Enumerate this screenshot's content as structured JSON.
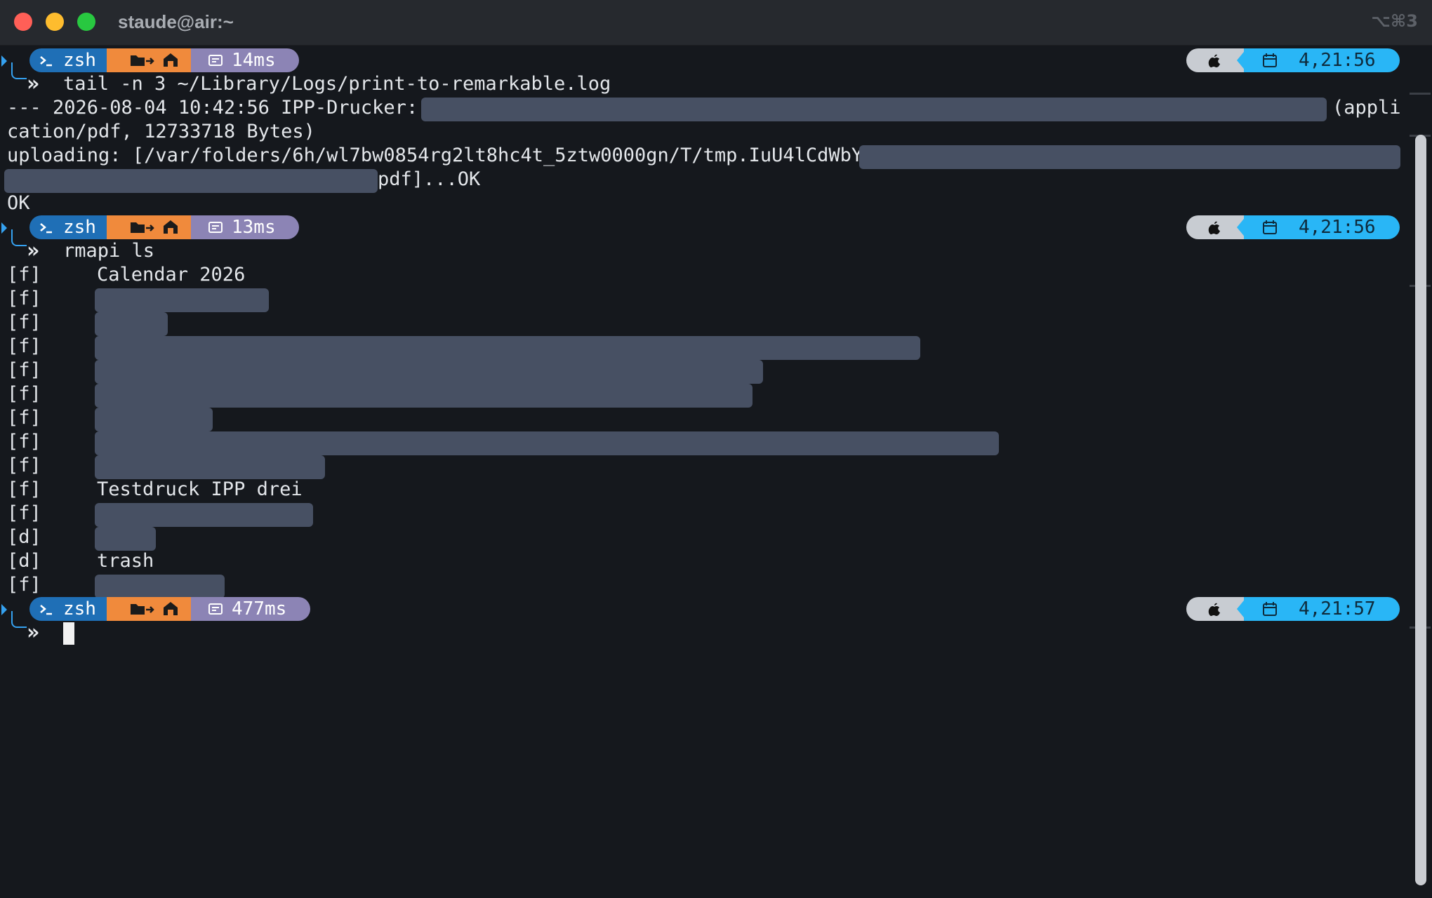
{
  "window": {
    "title": "staude@air:~",
    "shortcut": "⌥⌘3"
  },
  "prompts": [
    {
      "shell": "zsh",
      "duration": "14ms",
      "time": "4,21:56",
      "command": "tail -n 3 ~/Library/Logs/print-to-remarkable.log"
    },
    {
      "shell": "zsh",
      "duration": "13ms",
      "time": "4,21:56",
      "command": "rmapi ls"
    },
    {
      "shell": "zsh",
      "duration": "477ms",
      "time": "4,21:57",
      "command": ""
    }
  ],
  "log": {
    "line1_prefix": "--- 2026-08-04 10:42:56 IPP-Drucker: ",
    "line1_suffix": "(appli",
    "line2": "cation/pdf, 12733718 Bytes)",
    "line3": "uploading: [/var/folders/6h/wl7bw0854rg2lt8hc4t_5ztw0000gn/T/tmp.IuU4lCdWbY/",
    "line4_suffix": "pdf]...OK",
    "line5": "OK"
  },
  "listing": [
    {
      "type": "[f]",
      "name": "Calendar 2026"
    },
    {
      "type": "[f]",
      "name": ""
    },
    {
      "type": "[f]",
      "name": ""
    },
    {
      "type": "[f]",
      "name": ""
    },
    {
      "type": "[f]",
      "name": ""
    },
    {
      "type": "[f]",
      "name": ""
    },
    {
      "type": "[f]",
      "name": ""
    },
    {
      "type": "[f]",
      "name": ""
    },
    {
      "type": "[f]",
      "name": ""
    },
    {
      "type": "[f]",
      "name": "Testdruck IPP drei"
    },
    {
      "type": "[f]",
      "name": ""
    },
    {
      "type": "[d]",
      "name": ""
    },
    {
      "type": "[d]",
      "name": "trash"
    },
    {
      "type": "[f]",
      "name": ""
    }
  ],
  "icons": {
    "terminal": "terminal-icon",
    "folder": "folder-icon",
    "home": "home-icon",
    "timer": "timer-icon",
    "apple": "apple-icon",
    "calendar": "calendar-icon"
  },
  "colors": {
    "background": "#15181d",
    "segment_blue": "#1f6fb6",
    "segment_orange": "#f08a3c",
    "segment_purple": "#8c84b5",
    "segment_grey": "#c8ccd2",
    "segment_cyan": "#29b6f6",
    "redaction": "#475063"
  }
}
